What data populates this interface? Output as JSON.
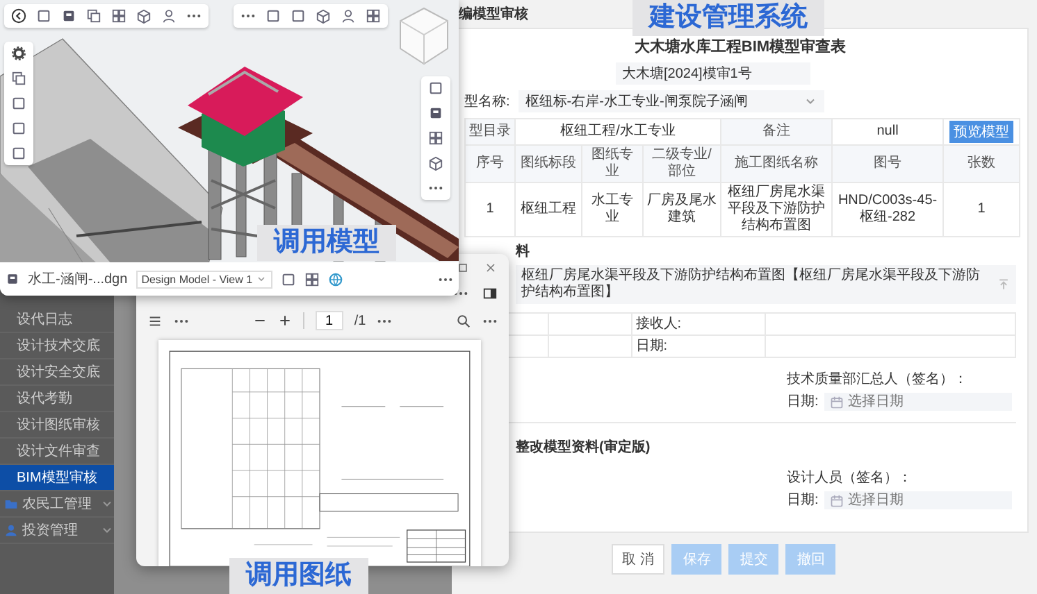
{
  "header": {
    "breadcrumb": "编模型审核",
    "system_caption": "建设管理系统"
  },
  "sidebar": {
    "items": [
      {
        "label": "设代日志",
        "kind": "link",
        "selected": false
      },
      {
        "label": "设计技术交底",
        "kind": "link",
        "selected": false
      },
      {
        "label": "设计安全交底",
        "kind": "link",
        "selected": false
      },
      {
        "label": "设代考勤",
        "kind": "link",
        "selected": false
      },
      {
        "label": "设计图纸审核",
        "kind": "link",
        "selected": false
      },
      {
        "label": "设计文件审查",
        "kind": "link",
        "selected": false
      },
      {
        "label": "BIM模型审核",
        "kind": "link",
        "selected": true
      },
      {
        "label": "农民工管理",
        "kind": "group",
        "selected": false
      },
      {
        "label": "投资管理",
        "kind": "group",
        "selected": false
      }
    ]
  },
  "form": {
    "title": "大木塘水库工程BIM模型审查表",
    "number": "大木塘[2024]模审1号",
    "model_name_label": "型名称:",
    "model_name": "枢纽标-右岸-水工专业-闸泵院子涵闸",
    "catalog": {
      "label": "型目录",
      "value": "枢纽工程/水工专业",
      "remark_label": "备注",
      "remark": "null",
      "button": "预览模型"
    },
    "table": {
      "columns": [
        "序号",
        "图纸标段",
        "图纸专业",
        "二级专业/部位",
        "施工图纸名称",
        "图号",
        "张数"
      ],
      "rows": [
        {
          "cells": [
            "1",
            "枢纽工程",
            "水工专业",
            "厂房及尾水建筑",
            "枢纽厂房尾水渠平段及下游防护结构布置图",
            "HND/C003s-45-枢纽-282",
            "1"
          ]
        }
      ]
    },
    "attachments": {
      "heading": "料",
      "files": [
        "枢纽厂房尾水渠平段及下游防护结构布置图【枢纽厂房尾水渠平段及下游防护结构布置图】"
      ]
    },
    "receipt": {
      "receiver_label": "接收人:",
      "date_label": "日期:"
    },
    "tech_sign": {
      "label": "技术质量部汇总人（签名）：",
      "date_label": "日期:",
      "date_placeholder": "选择日期"
    },
    "revision": {
      "heading": "整改模型资料(审定版)",
      "sign_label": "设计人员（签名）：",
      "date_label": "日期:",
      "date_placeholder": "选择日期"
    },
    "buttons": [
      {
        "label": "取 消",
        "kind": "default",
        "disabled": false
      },
      {
        "label": "保存",
        "kind": "primary",
        "disabled": true
      },
      {
        "label": "提交",
        "kind": "primary",
        "disabled": true
      },
      {
        "label": "撤回",
        "kind": "primary",
        "disabled": true
      }
    ]
  },
  "bim_viewer": {
    "file_name": "水工-涵闸-...dgn",
    "view": "Design Model - View 1",
    "caption": "调用模型"
  },
  "pdf_viewer": {
    "page": "1",
    "page_count": "/1",
    "caption": "调用图纸"
  }
}
